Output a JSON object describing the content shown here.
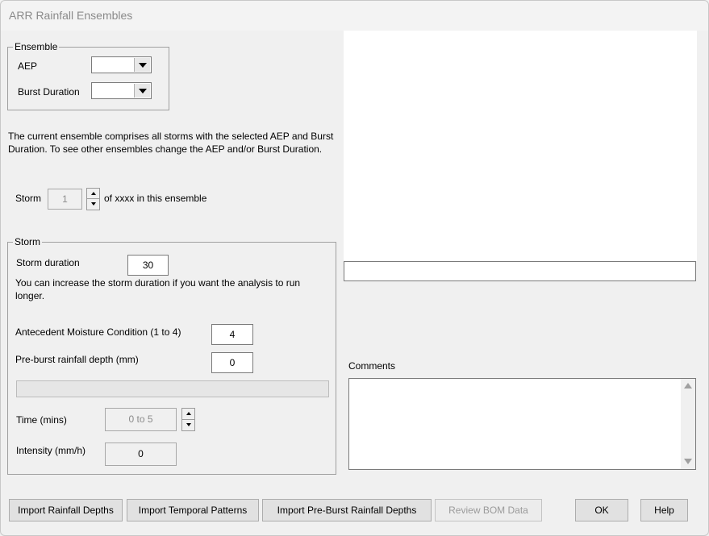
{
  "window": {
    "title": "ARR Rainfall Ensembles"
  },
  "ensemble": {
    "legend": "Ensemble",
    "aep_label": "AEP",
    "aep_value": "",
    "burst_label": "Burst Duration",
    "burst_value": ""
  },
  "info_text": "The current ensemble comprises all storms with the selected AEP and Burst Duration.  To see other ensembles change the AEP and/or Burst Duration.",
  "storm_selector": {
    "label": "Storm",
    "value": "1",
    "suffix": "of xxxx in this ensemble"
  },
  "storm": {
    "legend": "Storm",
    "duration_label": "Storm duration",
    "duration_value": "30",
    "duration_note": "You can increase the storm duration if you want the analysis to run longer.",
    "amc_label": "Antecedent Moisture Condition (1 to 4)",
    "amc_value": "4",
    "preburst_label": "Pre-burst rainfall depth (mm)",
    "preburst_value": "0",
    "time_label": "Time (mins)",
    "time_value": "0 to 5",
    "intensity_label": "Intensity (mm/h)",
    "intensity_value": "0"
  },
  "chart_caption": "",
  "comments": {
    "label": "Comments",
    "value": ""
  },
  "buttons": {
    "import_rainfall": "Import Rainfall Depths",
    "import_temporal": "Import Temporal Patterns",
    "import_preburst": "Import Pre-Burst Rainfall Depths",
    "review_bom": "Review BOM Data",
    "ok": "OK",
    "help": "Help"
  }
}
